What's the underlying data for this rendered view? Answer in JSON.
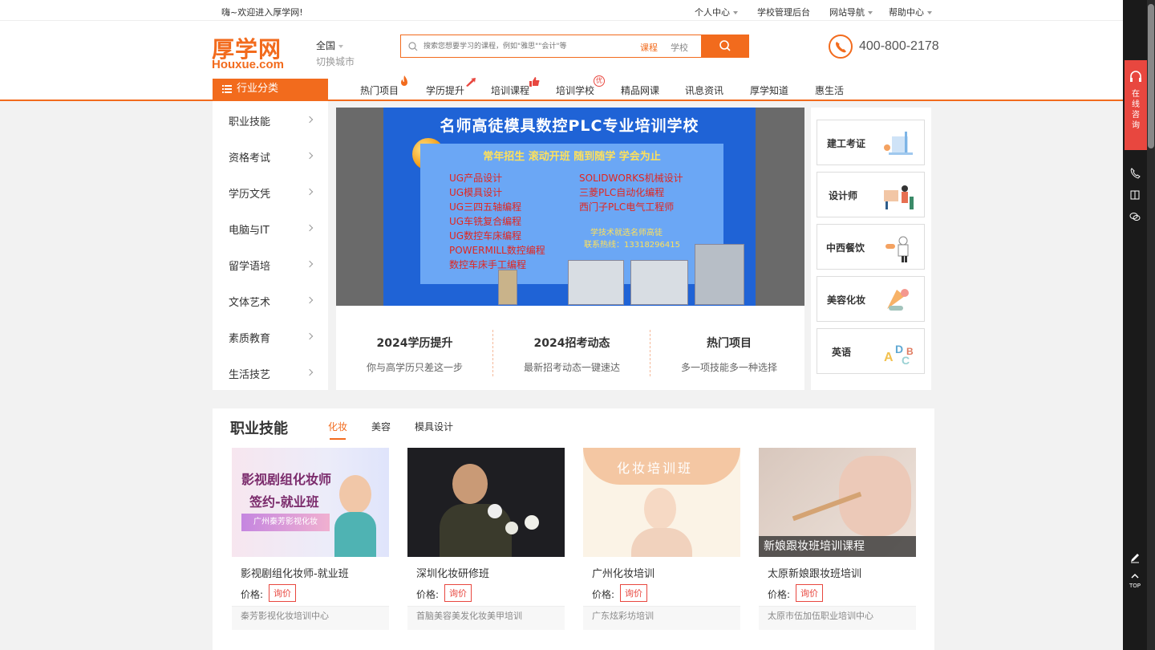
{
  "topbar": {
    "welcome": "嗨~欢迎进入厚学网!",
    "links": [
      "个人中心",
      "学校管理后台",
      "网站导航",
      "帮助中心"
    ]
  },
  "header": {
    "logo_cn": "厚学网",
    "logo_en": "Houxue.com",
    "city": "全国",
    "city_switch": "切换城市",
    "search_placeholder": "搜索您想要学习的课程，例如\"雅思\"\"会计\"等",
    "search_tab_course": "课程",
    "search_tab_school": "学校",
    "phone": "400-800-2178"
  },
  "nav": {
    "category_button": "行业分类",
    "items": [
      "热门项目",
      "学历提升",
      "培训课程",
      "培训学校",
      "精品网课",
      "讯息资讯",
      "厚学知道",
      "惠生活"
    ],
    "badge_you": "优"
  },
  "categories": [
    "职业技能",
    "资格考试",
    "学历文凭",
    "电脑与IT",
    "留学语培",
    "文体艺术",
    "素质教育",
    "生活技艺"
  ],
  "banner": {
    "title": "名师高徒模具数控PLC专业培训学校",
    "subtitle": "常年招生 滚动开班 随到随学 学会为止",
    "left_courses": [
      "UG产品设计",
      "UG模具设计",
      "UG三四五轴编程",
      "UG车铣复合编程",
      "UG数控车床编程",
      "POWERMILL数控编程",
      "数控车床手工编程"
    ],
    "right_courses": [
      "SOLIDWORKS机械设计",
      "三菱PLC自动化编程",
      "西门子PLC电气工程师"
    ],
    "contact1": "学技术就选名师高徒",
    "contact2": "联系热线：13318296415"
  },
  "info_boxes": [
    {
      "title": "2024学历提升",
      "subtitle": "你与高学历只差这一步"
    },
    {
      "title": "2024招考动态",
      "subtitle": "最新招考动态一键速达"
    },
    {
      "title": "热门项目",
      "subtitle": "多一项技能多一种选择"
    }
  ],
  "right_cards": [
    "建工考证",
    "设计师",
    "中西餐饮",
    "美容化妆",
    "英语"
  ],
  "sidebar": {
    "consult": "在线咨询",
    "top": "TOP"
  },
  "section": {
    "title": "职业技能",
    "tabs": [
      "化妆",
      "美容",
      "模具设计"
    ],
    "price_label": "价格:",
    "price_button": "询价",
    "courses": [
      {
        "title": "影视剧组化妆师-就业班",
        "school": "秦芳影视化妆培训中心",
        "img_line1": "影视剧组化妆师",
        "img_line2": "签约-就业班",
        "img_line3": "广州秦芳影视化妆"
      },
      {
        "title": "深圳化妆研修班",
        "school": "首脑美容美发化妆美甲培训"
      },
      {
        "title": "广州化妆培训",
        "school": "广东炫彩坊培训",
        "img_line1": "化妆培训班"
      },
      {
        "title": "太原新娘跟妆班培训",
        "school": "太原市伍加伍职业培训中心",
        "img_line1": "新娘跟妆班培训课程"
      }
    ]
  },
  "colors": {
    "brand": "#f26b1d",
    "price": "#e8473f",
    "banner_bg": "#1f63d6"
  }
}
